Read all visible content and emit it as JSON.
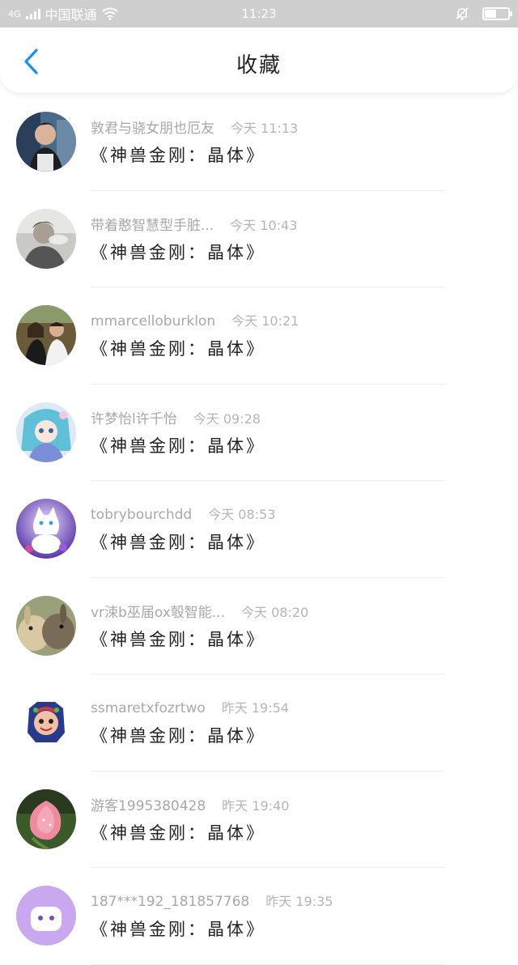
{
  "status_bar": {
    "carrier": "中国联通",
    "network": "4G",
    "time": "11:23"
  },
  "header": {
    "title": "收藏",
    "back_icon": "chevron-left-icon"
  },
  "colors": {
    "accent": "#1a8ff0",
    "status_bar_bg": "#cfcfcf"
  },
  "items": [
    {
      "user": "敦君与骁女朋也厄友",
      "time": "今天 11:13",
      "content": "《神兽金刚：晶体》",
      "avatar": "photo-man-street"
    },
    {
      "user": "带着憨智慧型手脏...",
      "time": "今天 10:43",
      "content": "《神兽金刚：晶体》",
      "avatar": "photo-man-smoke"
    },
    {
      "user": "mmarcelloburklon",
      "time": "今天 10:21",
      "content": "《神兽金刚：晶体》",
      "avatar": "photo-couple"
    },
    {
      "user": "许梦怡l许千怡",
      "time": "今天 09:28",
      "content": "《神兽金刚：晶体》",
      "avatar": "anime-girl"
    },
    {
      "user": "tobrybourchdd",
      "time": "今天 08:53",
      "content": "《神兽金刚：晶体》",
      "avatar": "white-cat"
    },
    {
      "user": "vr涑b巫届ox彀智能...",
      "time": "今天 08:20",
      "content": "《神兽金刚：晶体》",
      "avatar": "rabbits"
    },
    {
      "user": "ssmaretxfozrtwo",
      "time": "昨天 19:54",
      "content": "《神兽金刚：晶体》",
      "avatar": "cartoon-character"
    },
    {
      "user": "游客1995380428",
      "time": "昨天 19:40",
      "content": "《神兽金刚：晶体》",
      "avatar": "pink-flower"
    },
    {
      "user": "187***192_181857768",
      "time": "昨天 19:35",
      "content": "《神兽金刚：晶体》",
      "avatar": "purple-default"
    }
  ]
}
